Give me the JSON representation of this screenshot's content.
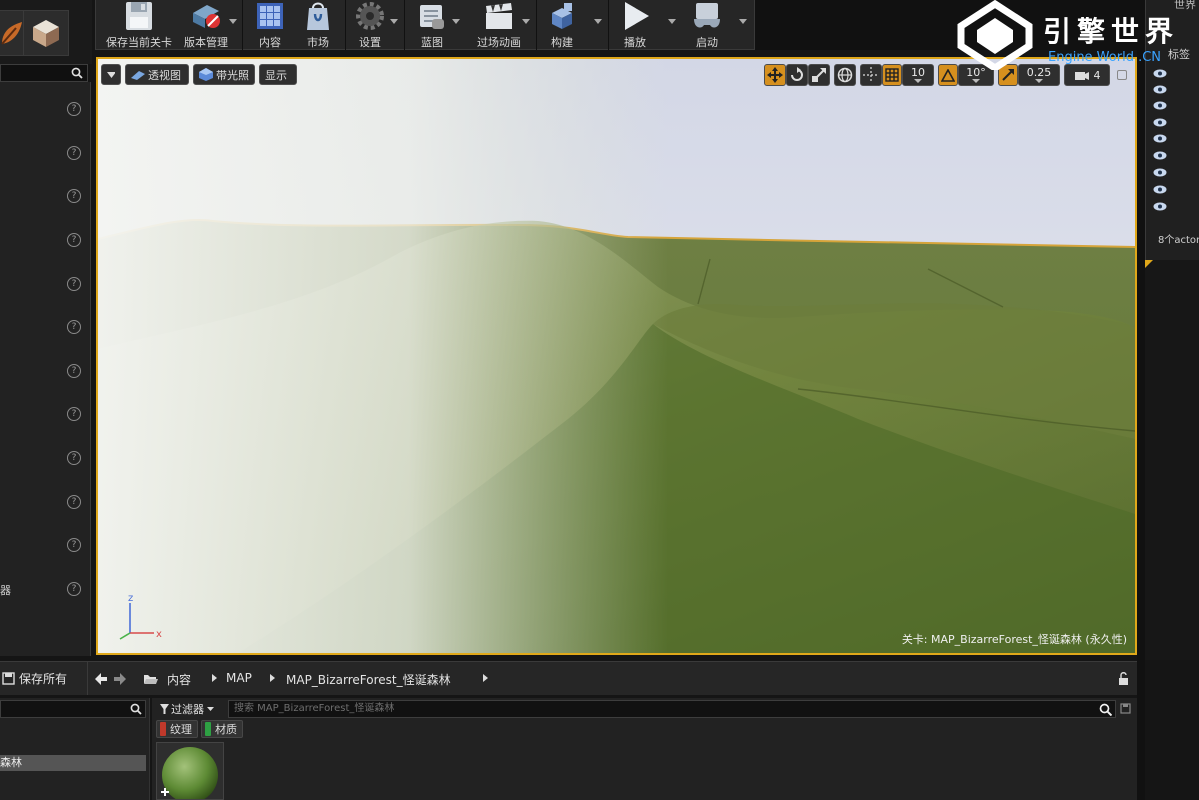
{
  "toolbar": {
    "buttons": [
      {
        "label": "保存当前关卡",
        "icon": "floppy-disk-icon"
      },
      {
        "label": "版本管理",
        "icon": "source-control-icon"
      },
      {
        "label": "内容",
        "icon": "content-grid-icon"
      },
      {
        "label": "市场",
        "icon": "marketplace-bag-icon"
      },
      {
        "label": "设置",
        "icon": "gear-icon"
      },
      {
        "label": "蓝图",
        "icon": "blueprint-icon"
      },
      {
        "label": "过场动画",
        "icon": "clapperboard-icon"
      },
      {
        "label": "构建",
        "icon": "build-cubes-icon"
      },
      {
        "label": "播放",
        "icon": "play-icon"
      },
      {
        "label": "启动",
        "icon": "launch-gamepad-icon"
      }
    ]
  },
  "logo": {
    "title": "引擎世界",
    "subtitle": "Engine World .CN"
  },
  "viewport": {
    "buttons": {
      "perspective": "透视图",
      "lit": "带光照",
      "show": "显示"
    },
    "snap": {
      "grid": "10",
      "rotation": "10°",
      "scale": "0.25",
      "camera_speed": "4"
    },
    "level_label": "关卡: MAP_BizarreForest_怪诞森林 (永久性)",
    "axes": {
      "z": "z",
      "x": "x"
    }
  },
  "left_panel": {
    "partial_label": "器"
  },
  "outliner": {
    "header": "世界",
    "tags_label": "标签",
    "actor_count": "8个actor"
  },
  "bottom": {
    "save_all": "保存所有",
    "breadcrumbs": [
      "内容",
      "MAP",
      "MAP_BizarreForest_怪诞森林"
    ],
    "filter_label": "过滤器",
    "search_placeholder": "搜索 MAP_BizarreForest_怪诞森林",
    "filters": [
      {
        "label": "纹理",
        "color": "#c0392b"
      },
      {
        "label": "材质",
        "color": "#2ea043"
      }
    ],
    "folder_item": "森林"
  },
  "colors": {
    "accent": "#e0a81a",
    "panel": "#222222",
    "terrain": "#6b7e40"
  }
}
